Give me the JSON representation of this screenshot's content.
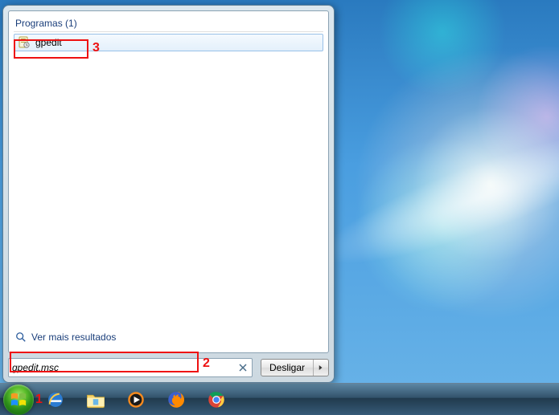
{
  "start_menu": {
    "category_header": "Programas (1)",
    "results": [
      {
        "label": "gpedit",
        "icon": "policy-icon"
      }
    ],
    "more_results_label": "Ver mais resultados",
    "search_value": "gpedit.msc",
    "shutdown_label": "Desligar"
  },
  "taskbar": {
    "items": [
      {
        "name": "start-button",
        "icon": "windows-orb"
      },
      {
        "name": "internet-explorer-icon",
        "icon": "ie"
      },
      {
        "name": "file-explorer-icon",
        "icon": "explorer"
      },
      {
        "name": "windows-media-player-icon",
        "icon": "wmp"
      },
      {
        "name": "firefox-icon",
        "icon": "firefox"
      },
      {
        "name": "chrome-icon",
        "icon": "chrome"
      }
    ]
  },
  "annotations": {
    "a1": "1",
    "a2": "2",
    "a3": "3"
  }
}
